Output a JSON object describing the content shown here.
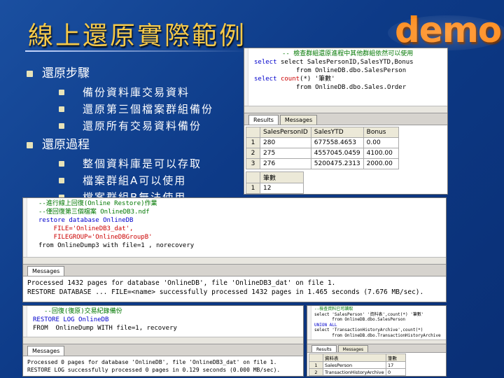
{
  "slide": {
    "title": "線上還原實際範例",
    "logo": "demo"
  },
  "bullets": [
    {
      "label": "還原步驟",
      "sub": [
        "備份資料庫交易資料",
        "還原第三個檔案群組備份",
        "還原所有交易資料備份"
      ]
    },
    {
      "label": "還原過程",
      "sub": [
        "整個資料庫是可以存取",
        "檔案群組A可以使用",
        "檔案群組B無法使用"
      ]
    }
  ],
  "top_window": {
    "code": {
      "comment": "-- 檢查群組還原進程中其他群組依然可以使用",
      "line1": "select SalesPersonID,SalesYTD,Bonus",
      "line2": "from OnlineDB.dbo.SalesPerson",
      "line3_kw": "select",
      "line3_fn": "count",
      "line3_rest": "(*) '筆數'",
      "line4": "from OnlineDB.dbo.Sales.Order"
    },
    "tabs": [
      "Results",
      "Messages"
    ],
    "grid1": {
      "columns": [
        "SalesPersonID",
        "SalesYTD",
        "Bonus"
      ],
      "rows": [
        [
          "1",
          "280",
          "677558.4653",
          "0.00"
        ],
        [
          "2",
          "275",
          "4557045.0459",
          "4100.00"
        ],
        [
          "3",
          "276",
          "5200475.2313",
          "2000.00"
        ]
      ]
    },
    "grid2": {
      "columns": [
        "筆數"
      ],
      "rows": [
        [
          "1",
          "12"
        ]
      ]
    }
  },
  "mid_window": {
    "code": [
      {
        "cls": "cm",
        "text": "--進行線上回復(Online Restore)作業"
      },
      {
        "cls": "cm",
        "text": "--僅回復第三個檔案 OnlineDB3.ndf"
      },
      {
        "cls": "kw",
        "text": "restore database OnlineDB"
      },
      {
        "cls": "st",
        "text": "    FILE='OnlineDB3_dat',"
      },
      {
        "cls": "st",
        "text": "    FILEGROUP='OnlineDBGroupB'"
      },
      {
        "cls": "",
        "text": "from OnlineDump3 with file=1 , norecovery"
      }
    ],
    "tab": "Messages",
    "messages": [
      "Processed 1432 pages for database 'OnlineDB', file 'OnlineDB3_dat' on file 1.",
      "RESTORE DATABASE ... FILE=<name> successfully processed 1432 pages in 1.465 seconds (7.676 MB/sec)."
    ]
  },
  "bottom_left_window": {
    "code": [
      {
        "cls": "cm",
        "text": "--回復(復原)交易紀錄備份"
      },
      {
        "cls": "kw",
        "text": "RESTORE LOG OnlineDB"
      },
      {
        "cls": "",
        "text": "FROM  OnlineDump WITH file=1, recovery"
      }
    ],
    "tab": "Messages",
    "messages": [
      "Processed 0 pages for database 'OnlineDB', file 'OnlineDB3_dat' on file 1.",
      "RESTORE LOG successfully processed 0 pages in 0.129 seconds (0.000 MB/sec)."
    ]
  },
  "bottom_right_window": {
    "code": [
      {
        "cls": "cm",
        "text": "--檢查資料已可讀取"
      },
      {
        "cls": "",
        "text": "select 'SalesPerson' '資料表',count(*) '筆數'"
      },
      {
        "cls": "",
        "text": "       from OnlineDB.dbo.SalesPerson"
      },
      {
        "cls": "kw",
        "text": "UNION ALL"
      },
      {
        "cls": "",
        "text": "select 'TransactionHistoryArchive',count(*)"
      },
      {
        "cls": "",
        "text": "       from OnlineDB.dbo.TransactionHistoryArchive"
      }
    ],
    "tabs": [
      "Results",
      "Messages"
    ],
    "grid": {
      "columns": [
        "資料表",
        "筆數"
      ],
      "rows": [
        [
          "1",
          "SalesPerson",
          "17"
        ],
        [
          "2",
          "TransactionHistoryArchive",
          "0"
        ]
      ]
    }
  }
}
